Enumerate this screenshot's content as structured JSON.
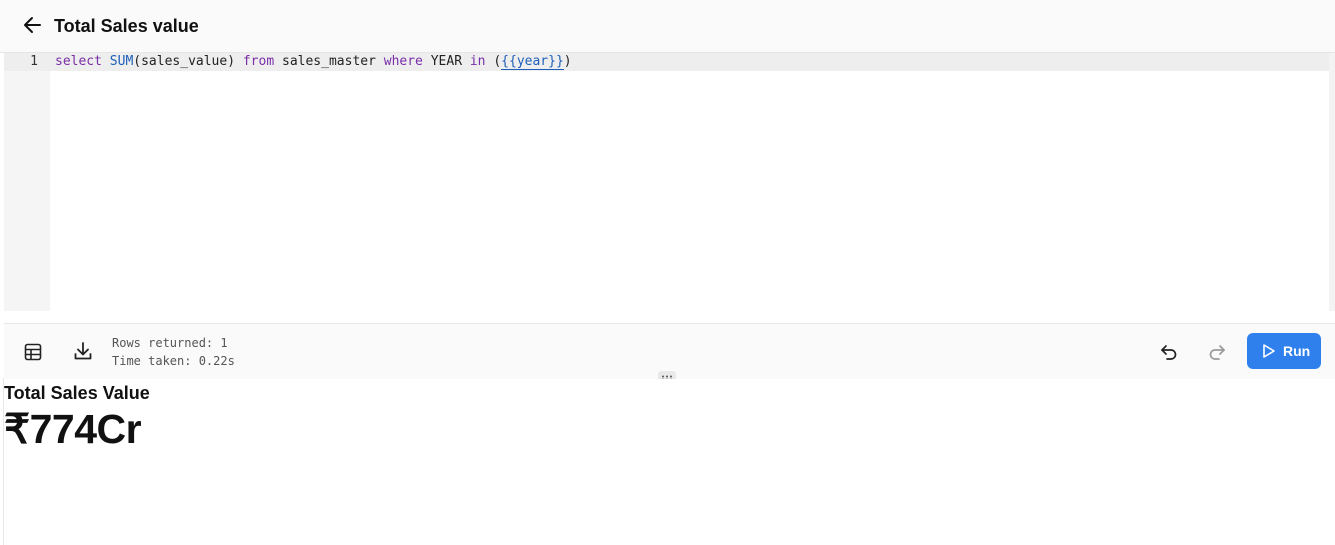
{
  "header": {
    "title": "Total Sales value",
    "back_icon": "arrow-left-icon"
  },
  "editor": {
    "line_number": "1",
    "tokens": {
      "select": "select",
      "fn": "SUM",
      "paren_open": "(",
      "arg": "sales_value",
      "paren_close": ")",
      "space1": " ",
      "from": "from",
      "table": " sales_master ",
      "where": "where",
      "col": " YEAR ",
      "in": "in",
      "space2": " ",
      "lparen": "(",
      "param": "{{year}}",
      "rparen": ")"
    }
  },
  "toolbar": {
    "table_icon": "table-icon",
    "download_icon": "download-icon",
    "rows_returned": "Rows returned: 1",
    "time_taken": "Time taken: 0.22s",
    "undo_icon": "undo-icon",
    "redo_icon": "redo-icon",
    "run_label": "Run"
  },
  "result": {
    "title": "Total Sales Value",
    "value": "₹774Cr"
  },
  "colors": {
    "accent": "#2f80ed",
    "keyword": "#7a2ea8",
    "function": "#1d5fb8"
  }
}
